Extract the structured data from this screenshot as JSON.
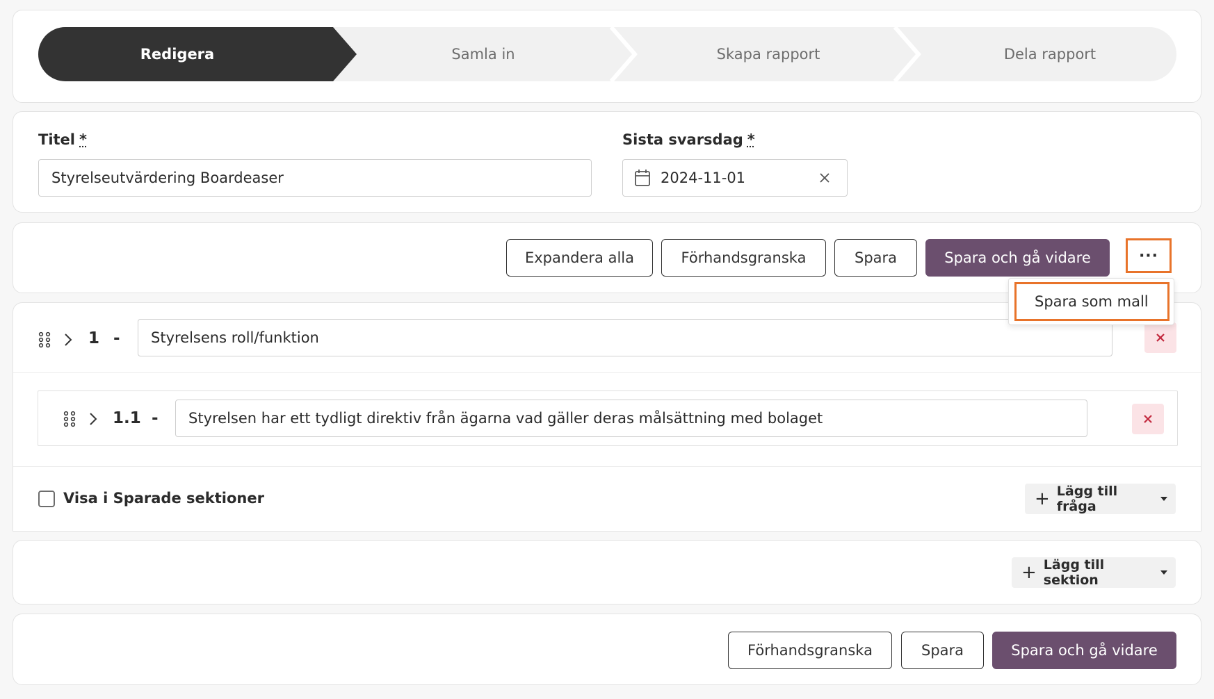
{
  "stepper": {
    "steps": [
      {
        "label": "Redigera",
        "active": true
      },
      {
        "label": "Samla in",
        "active": false
      },
      {
        "label": "Skapa rapport",
        "active": false
      },
      {
        "label": "Dela rapport",
        "active": false
      }
    ]
  },
  "form": {
    "title_label": "Titel",
    "title_required": "*",
    "title_value": "Styrelseutvärdering Boardeaser",
    "deadline_label": "Sista svarsdag",
    "deadline_required": "*",
    "deadline_value": "2024-11-01"
  },
  "toolbar": {
    "expand_all": "Expandera alla",
    "preview": "Förhandsgranska",
    "save": "Spara",
    "save_continue": "Spara och gå vidare",
    "more": "···",
    "more_menu": [
      "Spara som mall"
    ]
  },
  "section": {
    "number": "1",
    "dash": "-",
    "title": "Styrelsens roll/funktion",
    "questions": [
      {
        "number": "1.1",
        "dash": "-",
        "text": "Styrelsen har ett tydligt direktiv från ägarna vad gäller deras målsättning med bolaget"
      }
    ],
    "show_saved_label": "Visa i Sparade sektioner",
    "show_saved_checked": false,
    "add_question": "Lägg till fråga"
  },
  "add_section": "Lägg till sektion",
  "footer": {
    "preview": "Förhandsgranska",
    "save": "Spara",
    "save_continue": "Spara och gå vidare"
  },
  "colors": {
    "primary": "#6b4f6e",
    "active_step": "#333333",
    "highlight": "#e8732a",
    "danger_bg": "#fbe3e6",
    "danger": "#c2283d"
  }
}
